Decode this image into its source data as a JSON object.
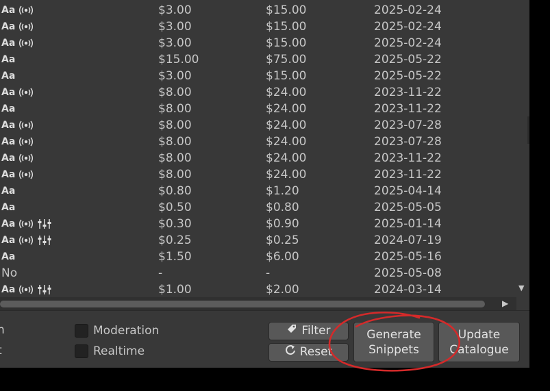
{
  "table": {
    "rows": [
      {
        "mod": [
          "aa",
          "broadcast"
        ],
        "input": "$3.00",
        "output": "$15.00",
        "date": "2025-02-24"
      },
      {
        "mod": [
          "aa",
          "broadcast"
        ],
        "input": "$3.00",
        "output": "$15.00",
        "date": "2025-02-24"
      },
      {
        "mod": [
          "aa",
          "broadcast"
        ],
        "input": "$3.00",
        "output": "$15.00",
        "date": "2025-02-24"
      },
      {
        "mod": [
          "aa"
        ],
        "input": "$15.00",
        "output": "$75.00",
        "date": "2025-05-22"
      },
      {
        "mod": [
          "aa"
        ],
        "input": "$3.00",
        "output": "$15.00",
        "date": "2025-05-22"
      },
      {
        "mod": [
          "aa",
          "broadcast"
        ],
        "input": "$8.00",
        "output": "$24.00",
        "date": "2023-11-22"
      },
      {
        "mod": [
          "aa"
        ],
        "input": "$8.00",
        "output": "$24.00",
        "date": "2023-11-22"
      },
      {
        "mod": [
          "aa",
          "broadcast"
        ],
        "input": "$8.00",
        "output": "$24.00",
        "date": "2023-07-28"
      },
      {
        "mod": [
          "aa",
          "broadcast"
        ],
        "input": "$8.00",
        "output": "$24.00",
        "date": "2023-07-28"
      },
      {
        "mod": [
          "aa",
          "broadcast"
        ],
        "input": "$8.00",
        "output": "$24.00",
        "date": "2023-11-22"
      },
      {
        "mod": [
          "aa",
          "broadcast"
        ],
        "input": "$8.00",
        "output": "$24.00",
        "date": "2023-11-22"
      },
      {
        "mod": [
          "aa"
        ],
        "input": "$0.80",
        "output": "$1.20",
        "date": "2025-04-14"
      },
      {
        "mod": [
          "aa"
        ],
        "input": "$0.50",
        "output": "$0.80",
        "date": "2025-05-05"
      },
      {
        "mod": [
          "aa",
          "broadcast",
          "sliders"
        ],
        "input": "$0.30",
        "output": "$0.90",
        "date": "2025-01-14"
      },
      {
        "mod": [
          "aa",
          "broadcast",
          "sliders"
        ],
        "input": "$0.25",
        "output": "$0.25",
        "date": "2024-07-19"
      },
      {
        "mod": [
          "aa"
        ],
        "input": "$1.50",
        "output": "$6.00",
        "date": "2025-05-16"
      },
      {
        "mod": [
          "no"
        ],
        "input": "-",
        "output": "-",
        "date": "2025-05-08"
      },
      {
        "mod": [
          "aa",
          "broadcast",
          "sliders"
        ],
        "input": "$1.00",
        "output": "$2.00",
        "date": "2024-03-14"
      }
    ],
    "mod_text": {
      "aa": "Aa",
      "no": "No"
    }
  },
  "filters": {
    "moderation_label": "Moderation",
    "moderation_checked": false,
    "realtime_label": "Realtime",
    "realtime_checked": false
  },
  "buttons": {
    "filter": "Filter",
    "reset": "Reset",
    "generate_line1": "Generate",
    "generate_line2": "Snippets",
    "update_line1": "Update",
    "update_line2": "Catalogue"
  },
  "icons": {
    "filter": "tag-icon",
    "reset": "refresh-icon",
    "modality": [
      "text-icon",
      "broadcast-icon",
      "sliders-icon"
    ]
  },
  "colors": {
    "annotation": "#d42a2a",
    "panel": "#383838",
    "button": "#585858"
  }
}
